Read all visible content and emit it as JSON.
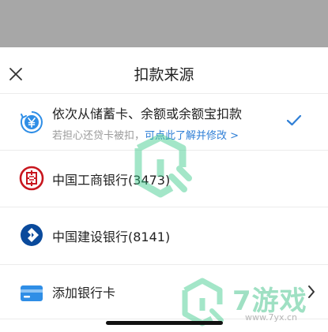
{
  "sheet": {
    "title": "扣款来源",
    "close_icon": "close-icon"
  },
  "options": [
    {
      "label": "依次从储蓄卡、余额或余额宝扣款",
      "subtext_prefix": "若担心还贷卡被扣，",
      "subtext_link": "可点此了解并修改 >",
      "icon": "yuan-sequence-icon",
      "selected": true
    },
    {
      "label": "中国工商银行(3473)",
      "icon": "icbc-logo-icon"
    },
    {
      "label": "中国建设银行(8141)",
      "icon": "ccb-logo-icon"
    },
    {
      "label": "添加银行卡",
      "icon": "bank-card-icon",
      "trailing_icon": "chevron-right-icon"
    }
  ],
  "watermark": {
    "name": "7游戏",
    "url": "www.7yx.cn"
  },
  "colors": {
    "accent": "#2f7fd6",
    "icbc_red": "#c8161e",
    "ccb_blue": "#0a4a9c",
    "card_blue": "#2f8ee6",
    "overlay": "#a7a7a7"
  }
}
